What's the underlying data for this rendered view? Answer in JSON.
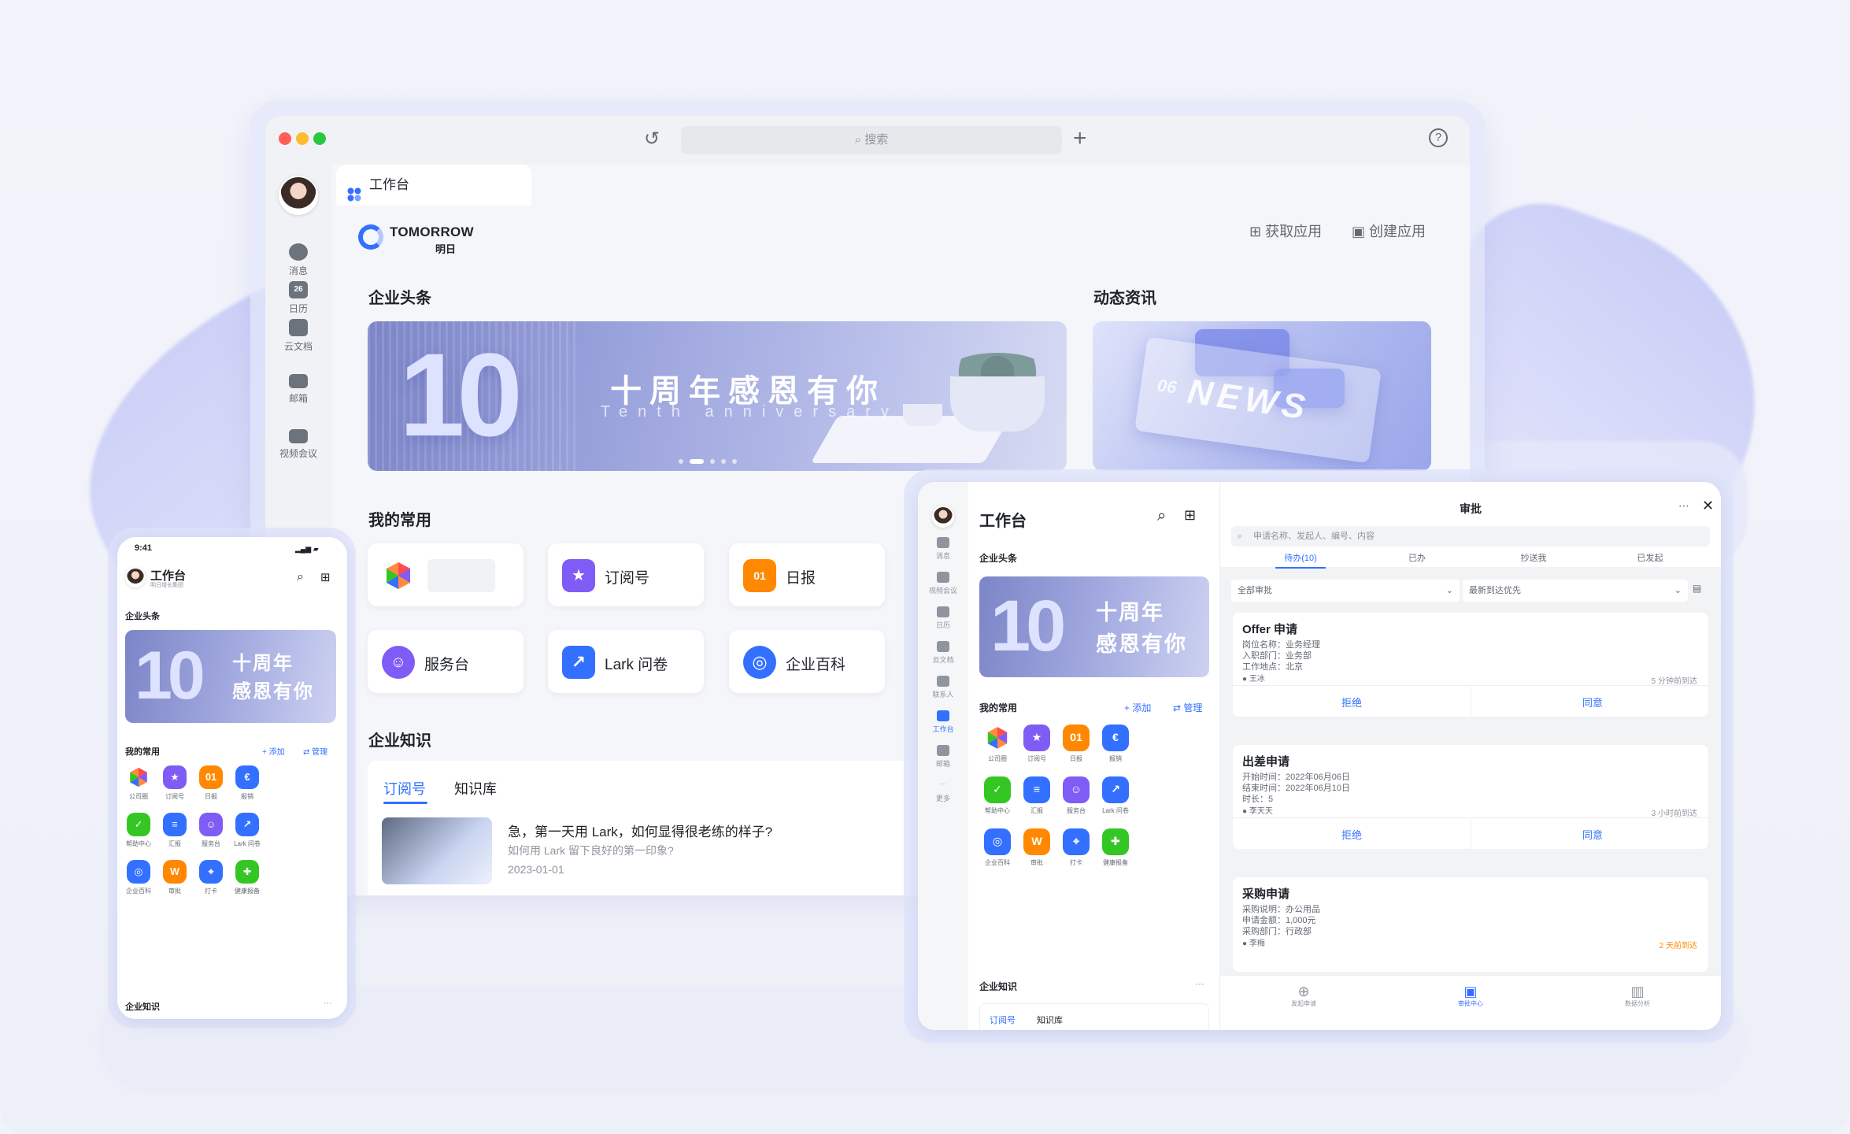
{
  "colors": {
    "accent": "#3370ff",
    "orange": "#ff8800",
    "green": "#34c724",
    "purple": "#7f5cf5"
  },
  "desktop": {
    "search_placeholder": "搜索",
    "tab_label": "工作台",
    "logo_en": "TOMORROW",
    "logo_cn": "明日",
    "header_actions": {
      "get_app": "获取应用",
      "create_app": "创建应用"
    },
    "nav": [
      {
        "label": "消息",
        "icon": "chat-icon"
      },
      {
        "label": "日历",
        "icon": "calendar-icon",
        "badge": "26"
      },
      {
        "label": "云文档",
        "icon": "document-icon"
      },
      {
        "label": "邮箱",
        "icon": "mail-icon"
      },
      {
        "label": "视频会议",
        "icon": "video-icon"
      }
    ],
    "headline_title": "企业头条",
    "banner": {
      "big": "10",
      "cn": "十周年感恩有你",
      "en": "Tenth anniversary"
    },
    "news_title": "动态资讯",
    "news_banner": {
      "num": "06",
      "word": "NEWS"
    },
    "common_title": "我的常用",
    "apps": [
      {
        "label": "",
        "icon": "hexagon-app-icon"
      },
      {
        "label": "订阅号",
        "icon": "subscription-icon"
      },
      {
        "label": "日报",
        "icon": "daily-report-icon",
        "glyph": "01"
      },
      {
        "label": "服务台",
        "icon": "service-desk-icon"
      },
      {
        "label": "Lark 问卷",
        "icon": "survey-icon"
      },
      {
        "label": "企业百科",
        "icon": "wiki-icon"
      }
    ],
    "knowledge_title": "企业知识",
    "knowledge_tabs": [
      "订阅号",
      "知识库"
    ],
    "article": {
      "title": "急，第一天用 Lark，如何显得很老练的样子?",
      "subtitle": "如何用 Lark 留下良好的第一印象?",
      "date": "2023-01-01"
    }
  },
  "phone": {
    "time": "9:41",
    "title": "工作台",
    "subtitle": "明日增长集团",
    "headline_title": "企业头条",
    "banner": {
      "big": "10",
      "line1": "十周年",
      "line2": "感恩有你"
    },
    "common_title": "我的常用",
    "add": "+ 添加",
    "manage": "⇄ 管理",
    "apps": [
      "公司圈",
      "订阅号",
      "日报",
      "报销",
      "帮助中心",
      "汇报",
      "服务台",
      "Lark 问卷",
      "企业百科",
      "审批",
      "打卡",
      "健康报备"
    ],
    "knowledge_title": "企业知识",
    "more": "···"
  },
  "tablet": {
    "title": "工作台",
    "nav": [
      "消息",
      "视频会议",
      "日历",
      "云文档",
      "联系人",
      "工作台",
      "邮箱",
      "更多"
    ],
    "headline_title": "企业头条",
    "banner": {
      "big": "10",
      "line1": "十周年",
      "line2": "感恩有你"
    },
    "common_title": "我的常用",
    "add": "+ 添加",
    "manage": "⇄ 管理",
    "apps": [
      "公司圈",
      "订阅号",
      "日报",
      "报销",
      "帮助中心",
      "汇报",
      "服务台",
      "Lark 问卷",
      "企业百科",
      "审批",
      "打卡",
      "健康报备"
    ],
    "knowledge_title": "企业知识",
    "knowledge_tabs": [
      "订阅号",
      "知识库"
    ],
    "more": "···",
    "approval": {
      "title": "审批",
      "search_placeholder": "申请名称、发起人、编号、内容",
      "tabs": [
        "待办(10)",
        "已办",
        "抄送我",
        "已发起"
      ],
      "filter1": "全部审批",
      "filter2": "最新到达优先",
      "reject": "拒绝",
      "agree": "同意",
      "cards": [
        {
          "title": "Offer 申请",
          "rows": [
            "岗位名称：业务经理",
            "入职部门：业务部",
            "工作地点：北京"
          ],
          "who": "王冰",
          "when": "5 分钟前到达"
        },
        {
          "title": "出差申请",
          "rows": [
            "开始时间：2022年06月06日",
            "结束时间：2022年06月10日",
            "时长：5"
          ],
          "who": "李天天",
          "when": "3 小时前到达"
        },
        {
          "title": "采购申请",
          "rows": [
            "采购说明：办公用品",
            "申请金额：1,000元",
            "采购部门：行政部"
          ],
          "who": "李梅",
          "when": "2 天前到达"
        }
      ],
      "bottom_tabs": [
        "发起申请",
        "审批中心",
        "数据分析"
      ]
    }
  }
}
